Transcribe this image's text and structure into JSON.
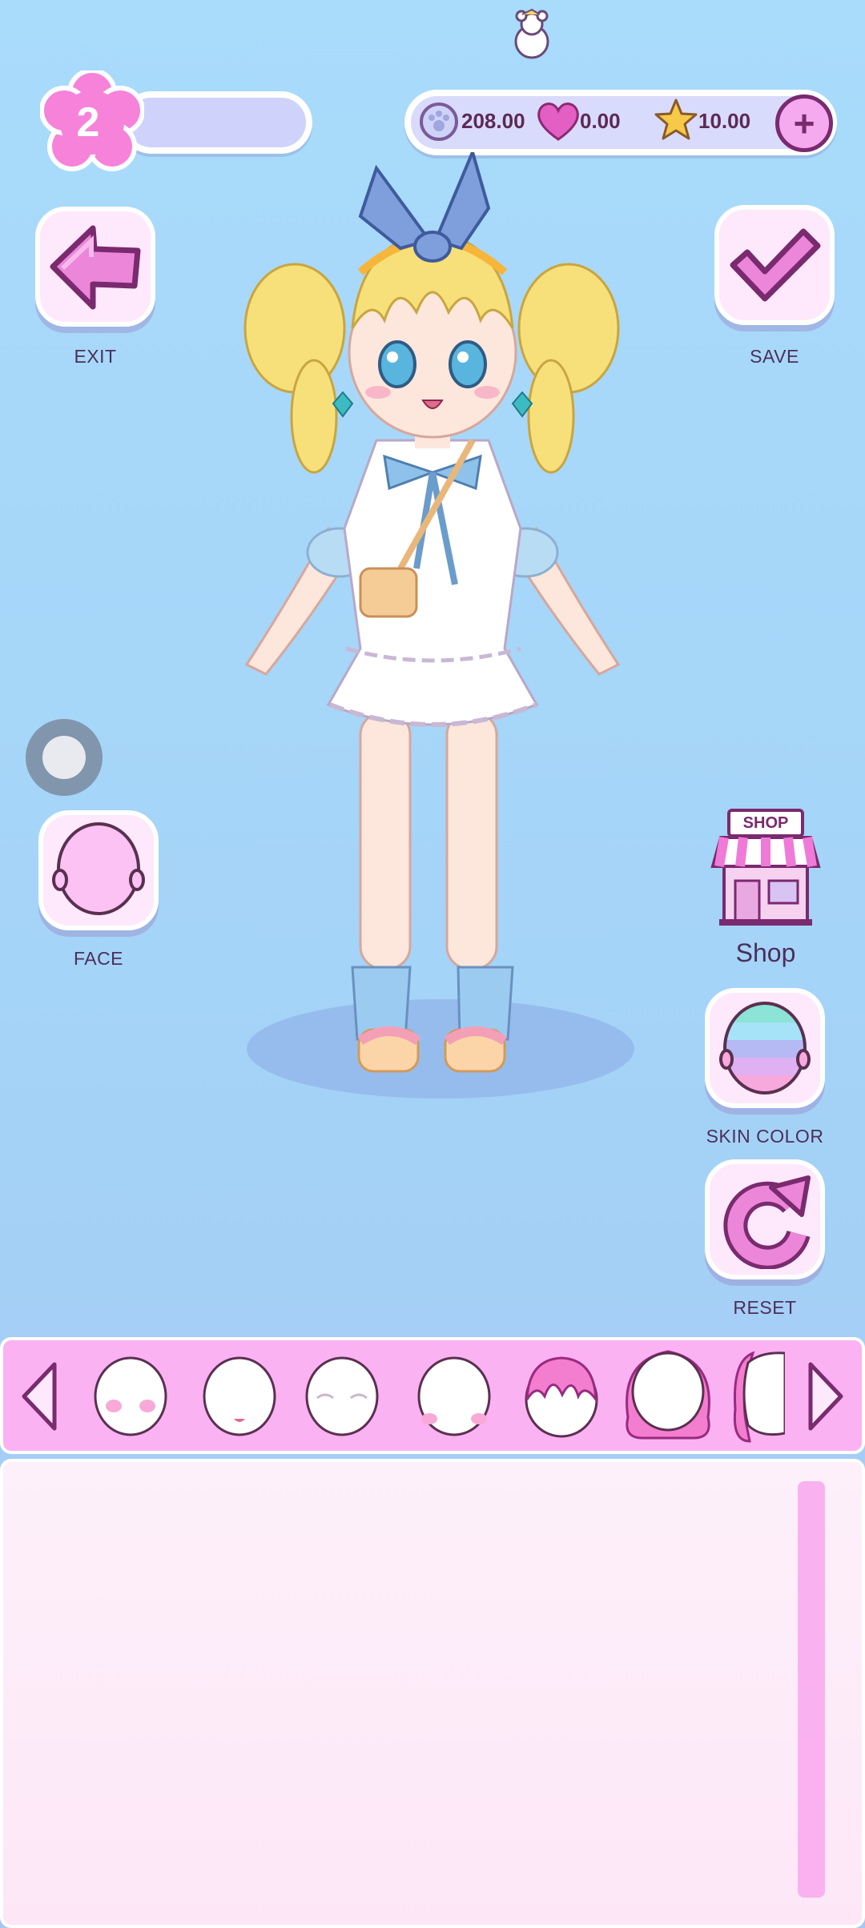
{
  "hud": {
    "level": "2",
    "currencies": [
      {
        "name": "paw-coins",
        "value": "208.00"
      },
      {
        "name": "hearts",
        "value": "0.00"
      },
      {
        "name": "stars",
        "value": "10.00"
      }
    ],
    "add_label": "+"
  },
  "buttons": {
    "exit": "EXIT",
    "save": "SAVE",
    "face": "FACE",
    "shop": "Shop",
    "shop_sign": "SHOP",
    "skin_color": "SKIN COLOR",
    "reset": "RESET"
  },
  "carousel": {
    "items": [
      "blush",
      "mouth",
      "eyes-closed",
      "cheeks",
      "hair-front",
      "hair-back",
      "hair-side"
    ]
  },
  "colors": {
    "accent_pink": "#fbb2f3",
    "outline_purple": "#7a2a6e",
    "sky_blue": "#a9dbfb"
  }
}
